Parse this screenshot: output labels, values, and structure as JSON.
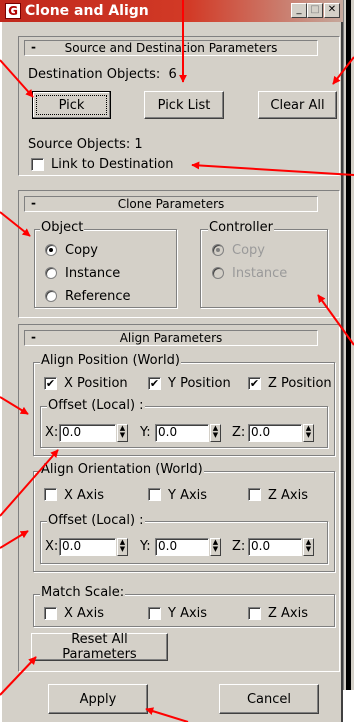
{
  "window": {
    "title": "Clone and Align",
    "icon_name": "3dsmax-icon",
    "min_label": "_",
    "max_label": "□",
    "close_label": "✕"
  },
  "source_dest": {
    "header": "Source and Destination Parameters",
    "collapse": "-",
    "dest_label": "Destination Objects:",
    "dest_count": "6",
    "pick": "Pick",
    "pick_list": "Pick List",
    "clear_all": "Clear All",
    "source_label": "Source Objects:",
    "source_count": "1",
    "link_label": "Link to Destination"
  },
  "clone": {
    "header": "Clone Parameters",
    "collapse": "-",
    "object_title": "Object",
    "object_options": [
      "Copy",
      "Instance",
      "Reference"
    ],
    "controller_title": "Controller",
    "controller_options": [
      "Copy",
      "Instance"
    ]
  },
  "align": {
    "header": "Align Parameters",
    "collapse": "-",
    "position_title": "Align Position (World)",
    "x_position": "X Position",
    "y_position": "Y Position",
    "z_position": "Z Position",
    "check_mark": "✔",
    "offset_title": "Offset (Local) :",
    "x": "X:",
    "y": "Y:",
    "z": "Z:",
    "pos_x": "0.0",
    "pos_y": "0.0",
    "pos_z": "0.0",
    "orient_title": "Align Orientation (World)",
    "x_axis": "X Axis",
    "y_axis": "Y Axis",
    "z_axis": "Z Axis",
    "orient_x": "0.0",
    "orient_y": "0.0",
    "orient_z": "0.0",
    "scale_title": "Match Scale:",
    "reset": "Reset All Parameters",
    "spin_up": "▲",
    "spin_down": "▼"
  },
  "footer": {
    "apply": "Apply",
    "cancel": "Cancel"
  },
  "annotation_color": "#ff0000"
}
